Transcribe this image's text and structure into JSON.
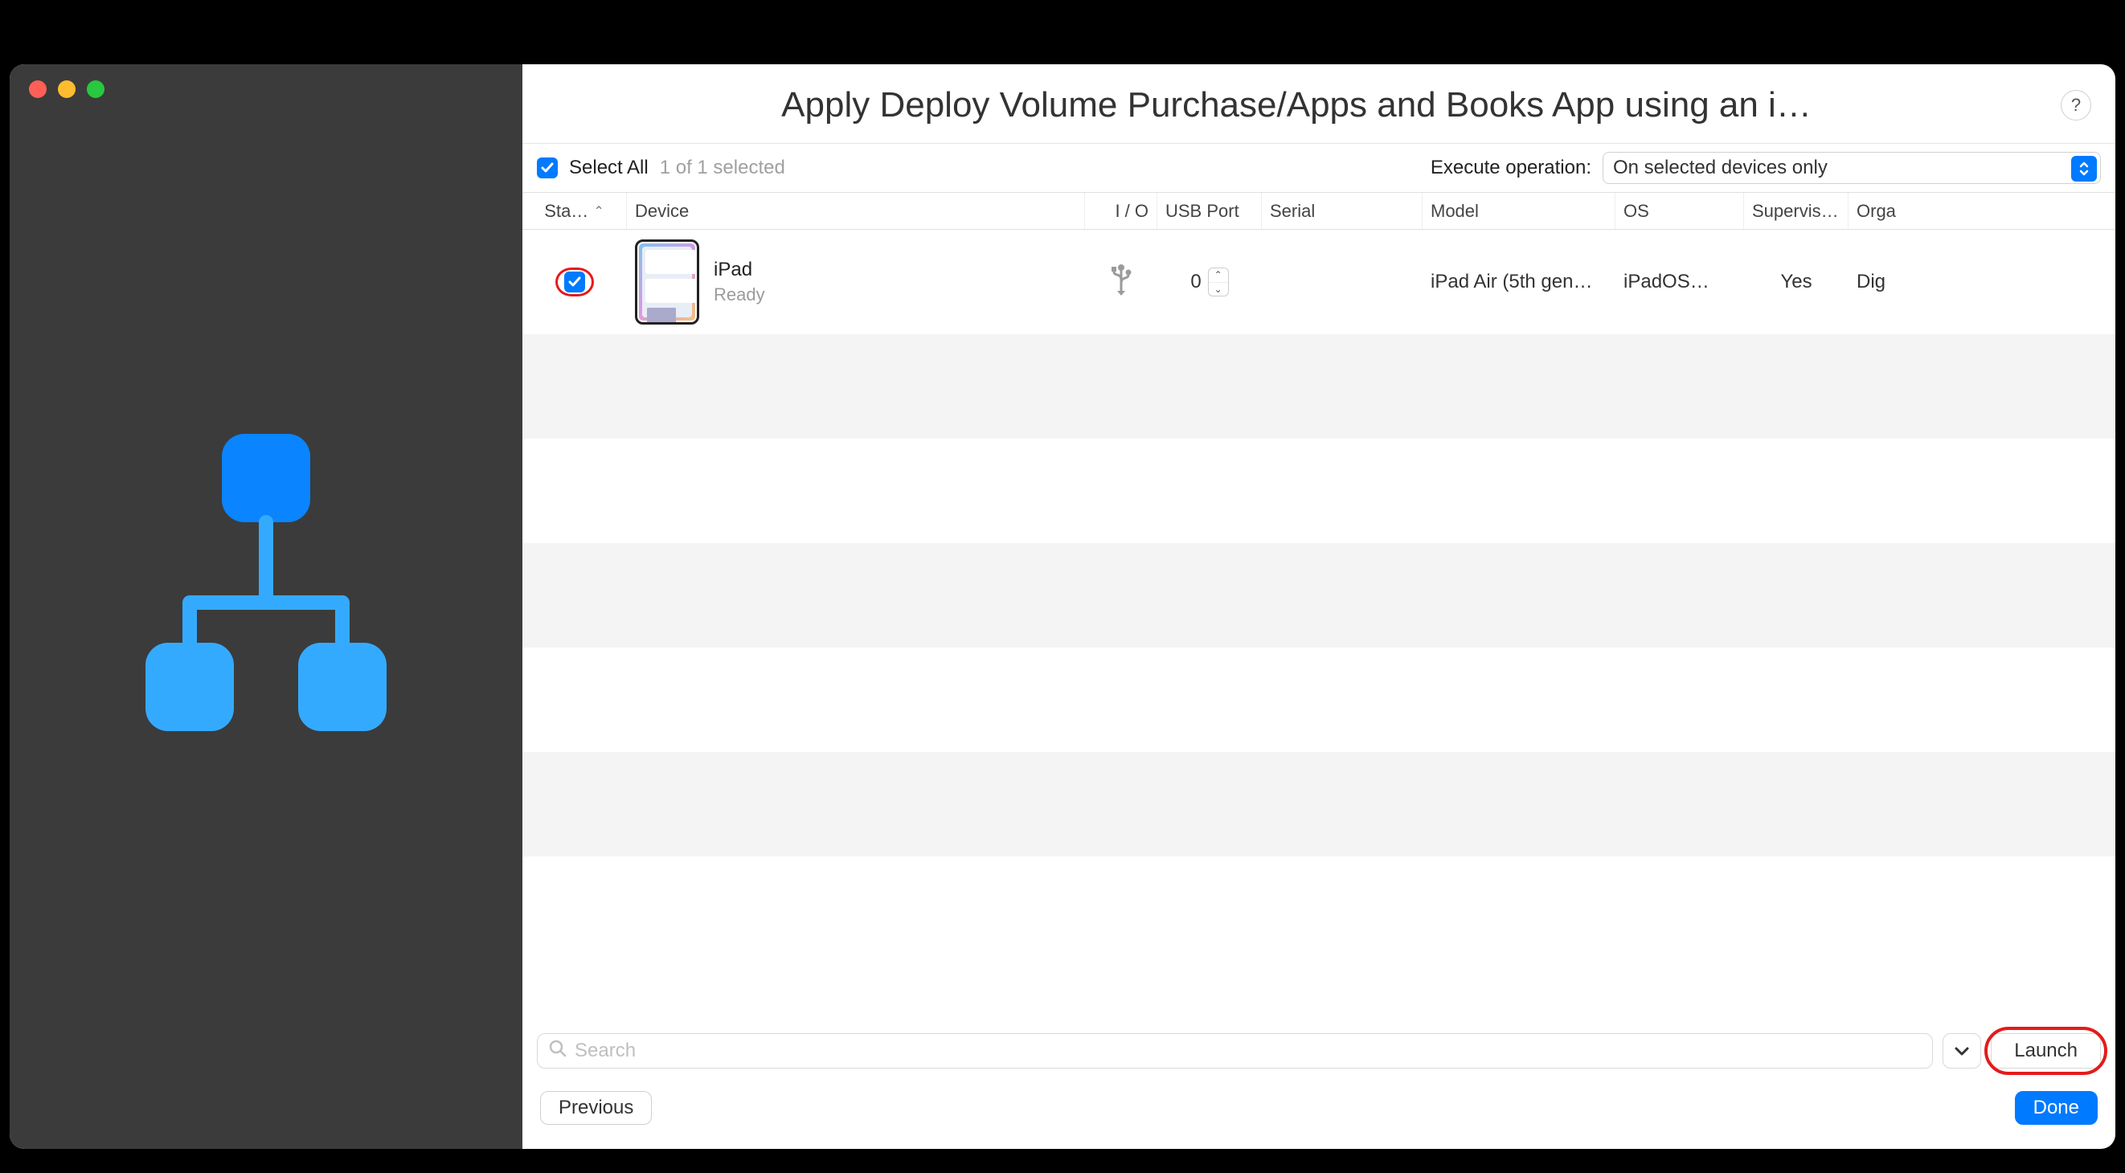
{
  "header": {
    "title": "Apply Deploy Volume Purchase/Apps and Books App using an  i…",
    "help_label": "?"
  },
  "toolbar": {
    "select_all_label": "Select All",
    "select_all_checked": true,
    "selected_count_label": "1 of 1 selected",
    "execute_label": "Execute operation:",
    "execute_value": "On selected devices only"
  },
  "table": {
    "columns": {
      "status": "Sta…",
      "device": "Device",
      "io": "I / O",
      "usb": "USB Port",
      "serial": "Serial",
      "model": "Model",
      "os": "OS",
      "supervised": "Supervis…",
      "org": "Orga"
    },
    "rows": [
      {
        "checked": true,
        "device_name": "iPad",
        "device_status": "Ready",
        "io_icon": "usb-icon",
        "usb_port": "0",
        "serial": "",
        "model": "iPad Air (5th gen…",
        "os": "iPadOS…",
        "supervised": "Yes",
        "org": "Dig"
      }
    ]
  },
  "search": {
    "placeholder": "Search",
    "launch_label": "Launch"
  },
  "footer": {
    "previous_label": "Previous",
    "done_label": "Done"
  }
}
